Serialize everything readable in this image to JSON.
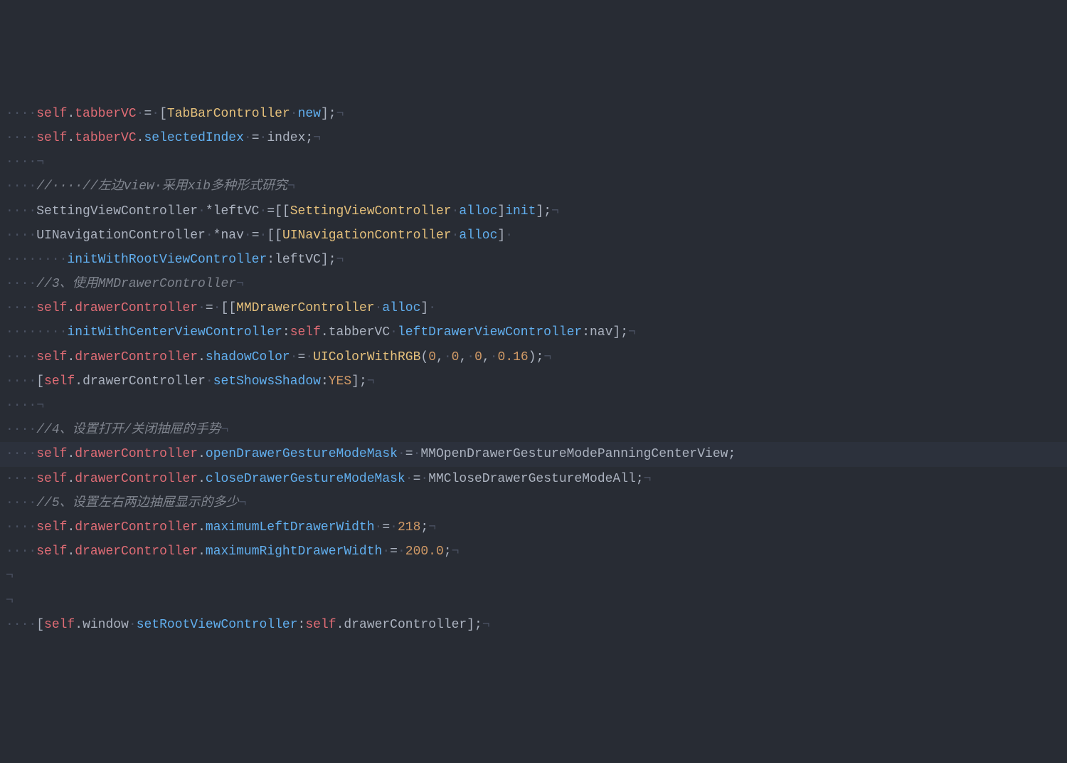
{
  "code": {
    "lines": [
      {
        "highlighted": false,
        "tokens": [
          {
            "cls": "ws",
            "t": "····"
          },
          {
            "cls": "self",
            "t": "self"
          },
          {
            "cls": "punct",
            "t": "."
          },
          {
            "cls": "property",
            "t": "tabberVC"
          },
          {
            "cls": "ws",
            "t": "·"
          },
          {
            "cls": "punct",
            "t": "="
          },
          {
            "cls": "ws",
            "t": "·"
          },
          {
            "cls": "punct",
            "t": "["
          },
          {
            "cls": "class",
            "t": "TabBarController"
          },
          {
            "cls": "ws",
            "t": "·"
          },
          {
            "cls": "method",
            "t": "new"
          },
          {
            "cls": "punct",
            "t": "];"
          },
          {
            "cls": "ws",
            "t": "¬"
          }
        ]
      },
      {
        "highlighted": false,
        "tokens": [
          {
            "cls": "ws",
            "t": "····"
          },
          {
            "cls": "self",
            "t": "self"
          },
          {
            "cls": "punct",
            "t": "."
          },
          {
            "cls": "property",
            "t": "tabberVC"
          },
          {
            "cls": "punct",
            "t": "."
          },
          {
            "cls": "method",
            "t": "selectedIndex"
          },
          {
            "cls": "ws",
            "t": "·"
          },
          {
            "cls": "punct",
            "t": "="
          },
          {
            "cls": "ws",
            "t": "·"
          },
          {
            "cls": "ident",
            "t": "index;"
          },
          {
            "cls": "ws",
            "t": "¬"
          }
        ]
      },
      {
        "highlighted": false,
        "tokens": [
          {
            "cls": "ws",
            "t": "····¬"
          }
        ]
      },
      {
        "highlighted": false,
        "tokens": [
          {
            "cls": "ws",
            "t": "····"
          },
          {
            "cls": "comment",
            "t": "//····//左边view·采用xib多种形式研究"
          },
          {
            "cls": "ws",
            "t": "¬"
          }
        ]
      },
      {
        "highlighted": false,
        "tokens": [
          {
            "cls": "ws",
            "t": "····"
          },
          {
            "cls": "ident",
            "t": "SettingViewController"
          },
          {
            "cls": "ws",
            "t": "·"
          },
          {
            "cls": "punct",
            "t": "*leftVC"
          },
          {
            "cls": "ws",
            "t": "·"
          },
          {
            "cls": "punct",
            "t": "=[["
          },
          {
            "cls": "class",
            "t": "SettingViewController"
          },
          {
            "cls": "ws",
            "t": "·"
          },
          {
            "cls": "method",
            "t": "alloc"
          },
          {
            "cls": "punct",
            "t": "]"
          },
          {
            "cls": "method",
            "t": "init"
          },
          {
            "cls": "punct",
            "t": "];"
          },
          {
            "cls": "ws",
            "t": "¬"
          }
        ]
      },
      {
        "highlighted": false,
        "tokens": [
          {
            "cls": "ws",
            "t": "····"
          },
          {
            "cls": "ident",
            "t": "UINavigationController"
          },
          {
            "cls": "ws",
            "t": "·"
          },
          {
            "cls": "punct",
            "t": "*nav"
          },
          {
            "cls": "ws",
            "t": "·"
          },
          {
            "cls": "punct",
            "t": "="
          },
          {
            "cls": "ws",
            "t": "·"
          },
          {
            "cls": "punct",
            "t": "[["
          },
          {
            "cls": "class",
            "t": "UINavigationController"
          },
          {
            "cls": "ws",
            "t": "·"
          },
          {
            "cls": "method",
            "t": "alloc"
          },
          {
            "cls": "punct",
            "t": "]"
          },
          {
            "cls": "ws",
            "t": "·"
          }
        ]
      },
      {
        "highlighted": false,
        "tokens": [
          {
            "cls": "ws",
            "t": "········"
          },
          {
            "cls": "method",
            "t": "initWithRootViewController"
          },
          {
            "cls": "punct",
            "t": ":leftVC];"
          },
          {
            "cls": "ws",
            "t": "¬"
          }
        ]
      },
      {
        "highlighted": false,
        "tokens": [
          {
            "cls": "ws",
            "t": "····"
          },
          {
            "cls": "comment",
            "t": "//3、使用MMDrawerController"
          },
          {
            "cls": "ws",
            "t": "¬"
          }
        ]
      },
      {
        "highlighted": false,
        "tokens": [
          {
            "cls": "ws",
            "t": "····"
          },
          {
            "cls": "self",
            "t": "self"
          },
          {
            "cls": "punct",
            "t": "."
          },
          {
            "cls": "property",
            "t": "drawerController"
          },
          {
            "cls": "ws",
            "t": "·"
          },
          {
            "cls": "punct",
            "t": "="
          },
          {
            "cls": "ws",
            "t": "·"
          },
          {
            "cls": "punct",
            "t": "[["
          },
          {
            "cls": "class",
            "t": "MMDrawerController"
          },
          {
            "cls": "ws",
            "t": "·"
          },
          {
            "cls": "method",
            "t": "alloc"
          },
          {
            "cls": "punct",
            "t": "]"
          },
          {
            "cls": "ws",
            "t": "·"
          }
        ]
      },
      {
        "highlighted": false,
        "tokens": [
          {
            "cls": "ws",
            "t": "········"
          },
          {
            "cls": "method",
            "t": "initWithCenterViewController"
          },
          {
            "cls": "punct",
            "t": ":"
          },
          {
            "cls": "self",
            "t": "self"
          },
          {
            "cls": "punct",
            "t": "."
          },
          {
            "cls": "ident",
            "t": "tabberVC"
          },
          {
            "cls": "ws",
            "t": "·"
          },
          {
            "cls": "method",
            "t": "leftDrawerViewController"
          },
          {
            "cls": "punct",
            "t": ":nav];"
          },
          {
            "cls": "ws",
            "t": "¬"
          }
        ]
      },
      {
        "highlighted": false,
        "tokens": [
          {
            "cls": "ws",
            "t": "····"
          },
          {
            "cls": "self",
            "t": "self"
          },
          {
            "cls": "punct",
            "t": "."
          },
          {
            "cls": "property",
            "t": "drawerController"
          },
          {
            "cls": "punct",
            "t": "."
          },
          {
            "cls": "method",
            "t": "shadowColor"
          },
          {
            "cls": "ws",
            "t": "·"
          },
          {
            "cls": "punct",
            "t": "="
          },
          {
            "cls": "ws",
            "t": "·"
          },
          {
            "cls": "func",
            "t": "UIColorWithRGB"
          },
          {
            "cls": "punct",
            "t": "("
          },
          {
            "cls": "number",
            "t": "0"
          },
          {
            "cls": "punct",
            "t": ","
          },
          {
            "cls": "ws",
            "t": "·"
          },
          {
            "cls": "number",
            "t": "0"
          },
          {
            "cls": "punct",
            "t": ","
          },
          {
            "cls": "ws",
            "t": "·"
          },
          {
            "cls": "number",
            "t": "0"
          },
          {
            "cls": "punct",
            "t": ","
          },
          {
            "cls": "ws",
            "t": "·"
          },
          {
            "cls": "number",
            "t": "0.16"
          },
          {
            "cls": "punct",
            "t": ");"
          },
          {
            "cls": "ws",
            "t": "¬"
          }
        ]
      },
      {
        "highlighted": false,
        "tokens": [
          {
            "cls": "ws",
            "t": "····"
          },
          {
            "cls": "punct",
            "t": "["
          },
          {
            "cls": "self",
            "t": "self"
          },
          {
            "cls": "punct",
            "t": "."
          },
          {
            "cls": "ident",
            "t": "drawerController"
          },
          {
            "cls": "ws",
            "t": "·"
          },
          {
            "cls": "method",
            "t": "setShowsShadow"
          },
          {
            "cls": "punct",
            "t": ":"
          },
          {
            "cls": "const",
            "t": "YES"
          },
          {
            "cls": "punct",
            "t": "];"
          },
          {
            "cls": "ws",
            "t": "¬"
          }
        ]
      },
      {
        "highlighted": false,
        "tokens": [
          {
            "cls": "ws",
            "t": "····¬"
          }
        ]
      },
      {
        "highlighted": false,
        "tokens": [
          {
            "cls": "ws",
            "t": "····"
          },
          {
            "cls": "comment",
            "t": "//4、设置打开/关闭抽屉的手势"
          },
          {
            "cls": "ws",
            "t": "¬"
          }
        ]
      },
      {
        "highlighted": true,
        "tokens": [
          {
            "cls": "ws",
            "t": "····"
          },
          {
            "cls": "self",
            "t": "self"
          },
          {
            "cls": "punct",
            "t": "."
          },
          {
            "cls": "property",
            "t": "drawerController"
          },
          {
            "cls": "punct",
            "t": "."
          },
          {
            "cls": "method",
            "t": "openDrawerGestureModeMask"
          },
          {
            "cls": "ws",
            "t": "·"
          },
          {
            "cls": "punct",
            "t": "="
          },
          {
            "cls": "ws",
            "t": "·"
          },
          {
            "cls": "ident",
            "t": "MMOpenDrawerGestureModePanningCenterView;"
          }
        ]
      },
      {
        "highlighted": false,
        "tokens": [
          {
            "cls": "ws",
            "t": "····"
          },
          {
            "cls": "self",
            "t": "self"
          },
          {
            "cls": "punct",
            "t": "."
          },
          {
            "cls": "property",
            "t": "drawerController"
          },
          {
            "cls": "punct",
            "t": "."
          },
          {
            "cls": "method",
            "t": "closeDrawerGestureModeMask"
          },
          {
            "cls": "ws",
            "t": "·"
          },
          {
            "cls": "punct",
            "t": "="
          },
          {
            "cls": "ws",
            "t": "·"
          },
          {
            "cls": "ident",
            "t": "MMCloseDrawerGestureModeAll;"
          },
          {
            "cls": "ws",
            "t": "¬"
          }
        ]
      },
      {
        "highlighted": false,
        "tokens": [
          {
            "cls": "ws",
            "t": "····"
          },
          {
            "cls": "comment",
            "t": "//5、设置左右两边抽屉显示的多少"
          },
          {
            "cls": "ws",
            "t": "¬"
          }
        ]
      },
      {
        "highlighted": false,
        "tokens": [
          {
            "cls": "ws",
            "t": "····"
          },
          {
            "cls": "self",
            "t": "self"
          },
          {
            "cls": "punct",
            "t": "."
          },
          {
            "cls": "property",
            "t": "drawerController"
          },
          {
            "cls": "punct",
            "t": "."
          },
          {
            "cls": "method",
            "t": "maximumLeftDrawerWidth"
          },
          {
            "cls": "ws",
            "t": "·"
          },
          {
            "cls": "punct",
            "t": "="
          },
          {
            "cls": "ws",
            "t": "·"
          },
          {
            "cls": "number",
            "t": "218"
          },
          {
            "cls": "punct",
            "t": ";"
          },
          {
            "cls": "ws",
            "t": "¬"
          }
        ]
      },
      {
        "highlighted": false,
        "tokens": [
          {
            "cls": "ws",
            "t": "····"
          },
          {
            "cls": "self",
            "t": "self"
          },
          {
            "cls": "punct",
            "t": "."
          },
          {
            "cls": "property",
            "t": "drawerController"
          },
          {
            "cls": "punct",
            "t": "."
          },
          {
            "cls": "method",
            "t": "maximumRightDrawerWidth"
          },
          {
            "cls": "ws",
            "t": "·"
          },
          {
            "cls": "punct",
            "t": "="
          },
          {
            "cls": "ws",
            "t": "·"
          },
          {
            "cls": "number",
            "t": "200.0"
          },
          {
            "cls": "punct",
            "t": ";"
          },
          {
            "cls": "ws",
            "t": "¬"
          }
        ]
      },
      {
        "highlighted": false,
        "tokens": [
          {
            "cls": "ws",
            "t": "¬"
          }
        ]
      },
      {
        "highlighted": false,
        "tokens": [
          {
            "cls": "ws",
            "t": "¬"
          }
        ]
      },
      {
        "highlighted": false,
        "tokens": [
          {
            "cls": "ws",
            "t": "····"
          },
          {
            "cls": "punct",
            "t": "["
          },
          {
            "cls": "self",
            "t": "self"
          },
          {
            "cls": "punct",
            "t": "."
          },
          {
            "cls": "ident",
            "t": "window"
          },
          {
            "cls": "ws",
            "t": "·"
          },
          {
            "cls": "method",
            "t": "setRootViewController"
          },
          {
            "cls": "punct",
            "t": ":"
          },
          {
            "cls": "self",
            "t": "self"
          },
          {
            "cls": "punct",
            "t": "."
          },
          {
            "cls": "ident",
            "t": "drawerController];"
          },
          {
            "cls": "ws",
            "t": "¬"
          }
        ]
      }
    ]
  }
}
